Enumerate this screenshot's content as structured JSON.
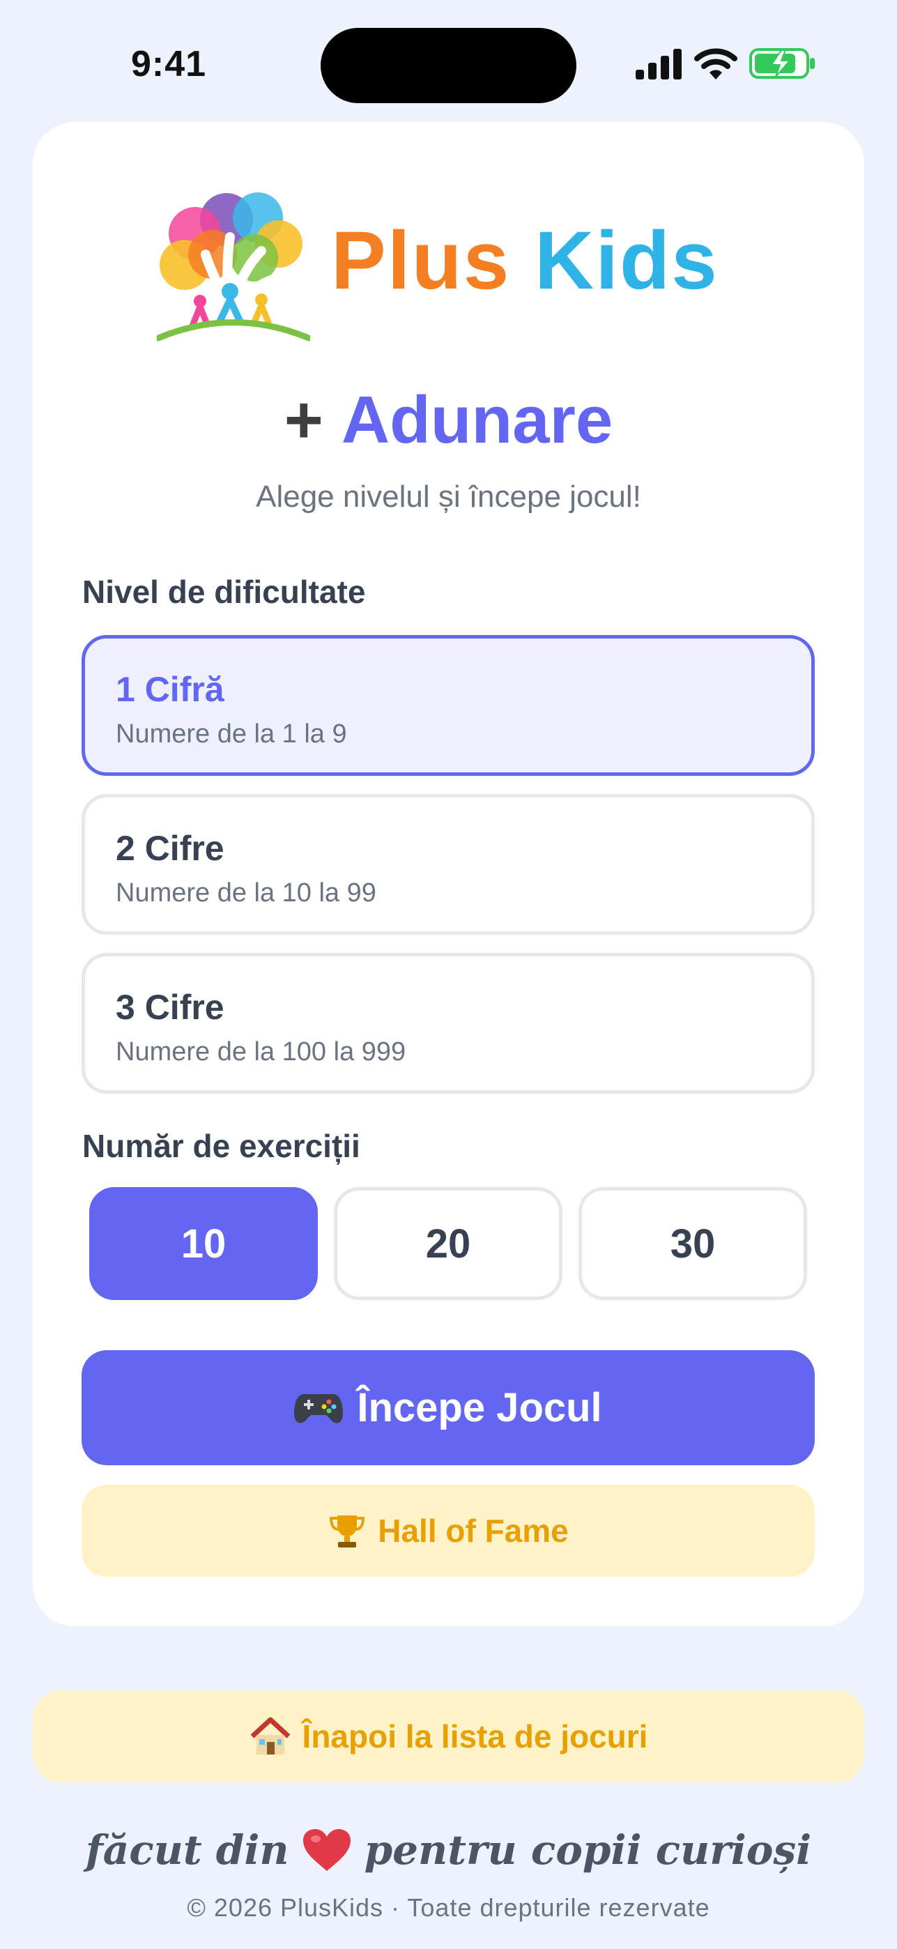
{
  "status_bar": {
    "time": "9:41"
  },
  "brand": {
    "part1": "Plus",
    "part2": "Kids"
  },
  "header": {
    "title_icon": "+",
    "title": "Adunare",
    "subtitle": "Alege nivelul și începe jocul!"
  },
  "difficulty": {
    "label": "Nivel de dificultate",
    "selected": "1 Cifră",
    "levels": [
      {
        "name": "1 Cifră",
        "desc": "Numere de la 1 la 9"
      },
      {
        "name": "2 Cifre",
        "desc": "Numere de la 10 la 99"
      },
      {
        "name": "3 Cifre",
        "desc": "Numere de la 100 la 999"
      }
    ]
  },
  "exercises": {
    "label": "Număr de exerciții",
    "selected": "10",
    "options": [
      "10",
      "20",
      "30"
    ]
  },
  "buttons": {
    "start": "Începe Jocul",
    "hall_of_fame": "Hall of Fame",
    "back": "Înapoi la lista de jocuri"
  },
  "footer": {
    "made_prefix": "făcut din",
    "made_suffix": "pentru copii curioși",
    "copyright": "© 2026 PlusKids · Toate drepturile rezervate"
  },
  "icons": {
    "start": "gamepad-icon",
    "hall_of_fame": "trophy-icon",
    "back": "house-icon",
    "footer": "heart-icon"
  },
  "colors": {
    "accent": "#6366f1",
    "yellow_bg": "#fef3c7",
    "yellow_text": "#e8a000",
    "brand_orange": "#f47f22",
    "brand_blue": "#2fb3e6"
  }
}
